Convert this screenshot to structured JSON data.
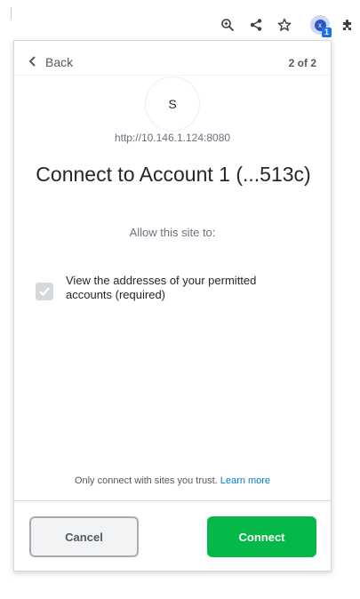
{
  "browser": {
    "toolbar_icons": [
      "zoom-icon",
      "share-icon",
      "bookmark-star-icon",
      "extension-avatar-icon",
      "puzzle-icon"
    ],
    "extension_avatar_letter": "x",
    "extension_badge": "1"
  },
  "popup": {
    "back_label": "Back",
    "page_counter": "2 of 2",
    "site_initial": "S",
    "site_url": "http://10.146.1.124:8080",
    "title": "Connect to Account 1 (...513c)",
    "subtitle": "Allow this site to:",
    "permission_label": "View the addresses of your permitted accounts (required)",
    "permission_checked": true,
    "trust_note": "Only connect with sites you trust.",
    "learn_more": "Learn more",
    "cancel_label": "Cancel",
    "connect_label": "Connect"
  },
  "colors": {
    "connect_green": "#05b949",
    "link_blue": "#037dd6",
    "text_dark": "#24272a",
    "text_muted": "#6a737d"
  }
}
